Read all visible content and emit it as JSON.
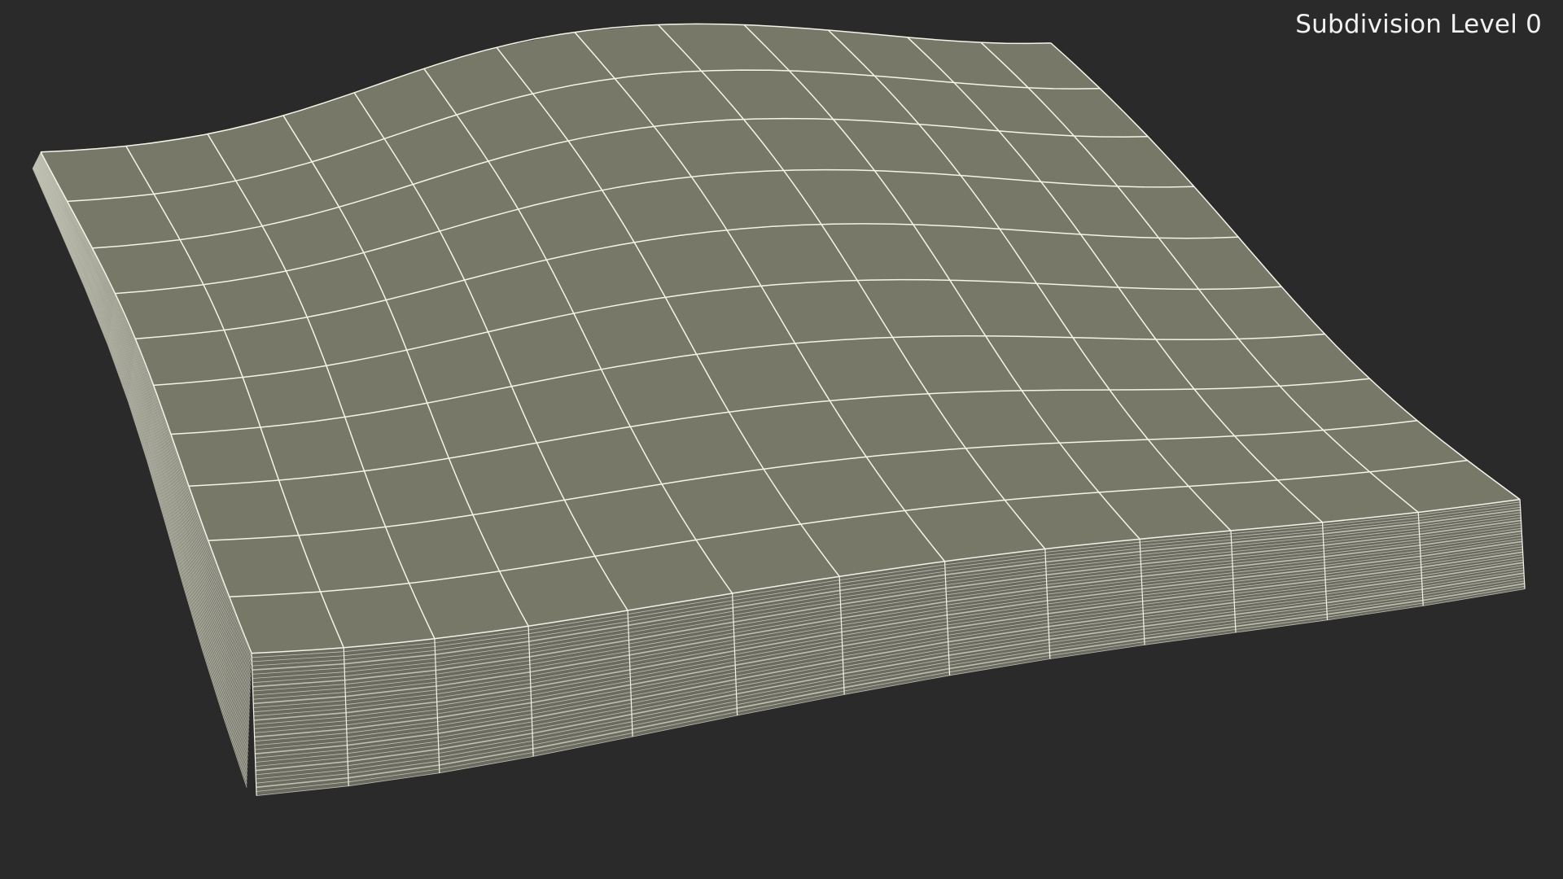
{
  "viewport": {
    "background_color": "#2a2a2a",
    "overlay_label": "Subdivision Level 0"
  },
  "mesh": {
    "top_face_color": "#787869",
    "side_face_color": "#6b6b5f",
    "wire_color": "#f4f4e8",
    "layer_color": "#cfcfc2"
  }
}
